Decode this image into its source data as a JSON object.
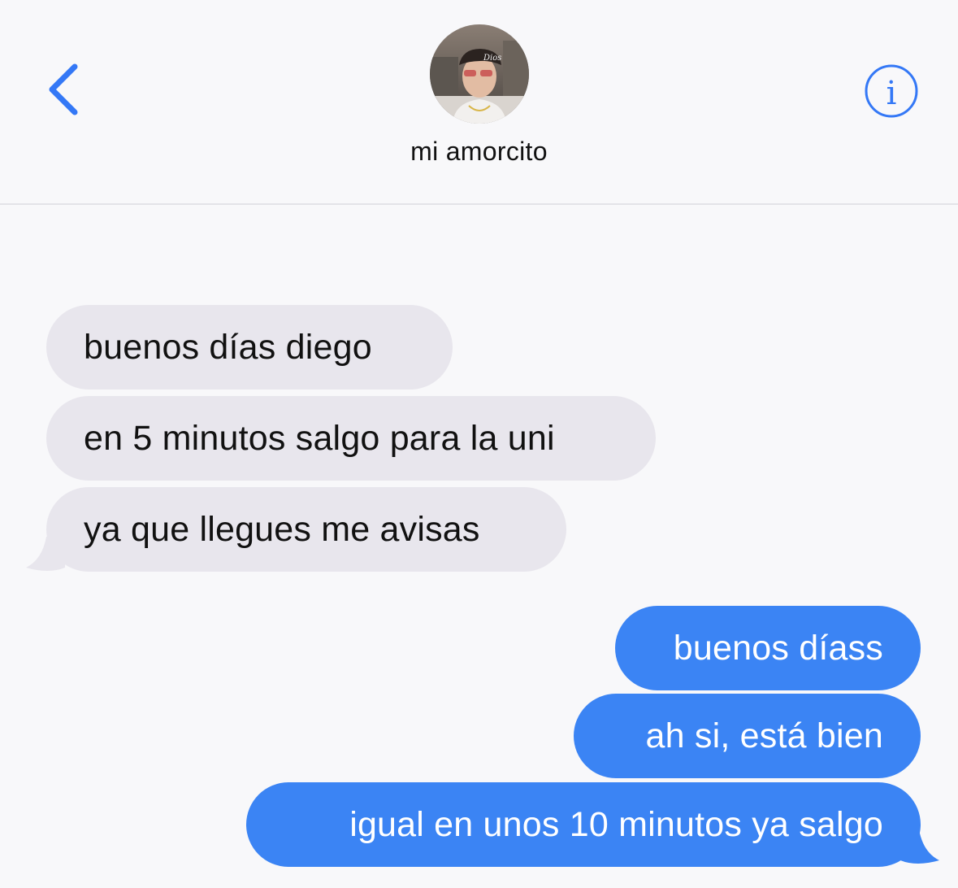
{
  "colors": {
    "background": "#f8f8fa",
    "accent": "#3478f6",
    "incoming_bubble": "#e8e6ed",
    "outgoing_bubble": "#3b84f4"
  },
  "header": {
    "back_icon": "chevron-left-icon",
    "contact_name": "mi amorcito",
    "info_icon": "info-circle-icon"
  },
  "messages": [
    {
      "direction": "incoming",
      "text": "buenos días diego"
    },
    {
      "direction": "incoming",
      "text": "en 5 minutos salgo para la uni"
    },
    {
      "direction": "incoming",
      "text": "ya que llegues me avisas"
    },
    {
      "direction": "outgoing",
      "text": "buenos díass"
    },
    {
      "direction": "outgoing",
      "text": "ah si, está bien"
    },
    {
      "direction": "outgoing",
      "text": "igual en unos 10 minutos ya salgo"
    }
  ]
}
